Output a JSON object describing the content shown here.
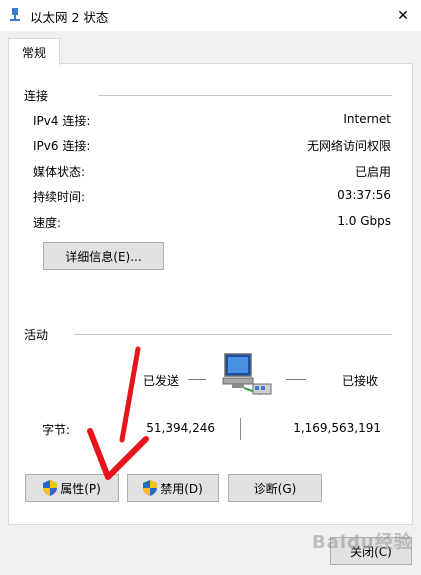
{
  "window": {
    "title": "以太网 2 状态"
  },
  "tabs": [
    {
      "label": "常规"
    }
  ],
  "connection": {
    "heading": "连接",
    "rows": [
      {
        "label": "IPv4 连接:",
        "value": "Internet"
      },
      {
        "label": "IPv6 连接:",
        "value": "无网络访问权限"
      },
      {
        "label": "媒体状态:",
        "value": "已启用"
      },
      {
        "label": "持续时间:",
        "value": "03:37:56"
      },
      {
        "label": "速度:",
        "value": "1.0 Gbps"
      }
    ],
    "details_button": "详细信息(E)..."
  },
  "activity": {
    "heading": "活动",
    "sent_label": "已发送",
    "received_label": "已接收",
    "bytes_label": "字节:",
    "bytes_sent": "51,394,246",
    "bytes_received": "1,169,563,191"
  },
  "buttons": {
    "properties": "属性(P)",
    "disable": "禁用(D)",
    "diagnose": "诊断(G)",
    "close": "关闭(C)"
  },
  "watermark": "Baidu经验",
  "colors": {
    "arrow": "#e8141c",
    "shield_blue": "#2b67c6",
    "shield_yellow": "#f5c21a"
  },
  "icons": [
    "network-icon",
    "close-icon",
    "shield-icon",
    "network-adapter-icon"
  ]
}
